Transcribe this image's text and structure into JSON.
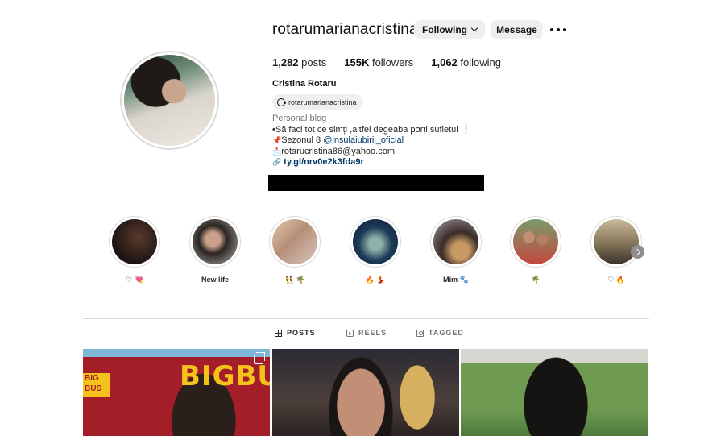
{
  "profile": {
    "username": "rotarumarianacristina",
    "verified": true,
    "following_label": "Following",
    "message_label": "Message",
    "posts_count": "1,282",
    "posts_label": "posts",
    "followers_count": "155K",
    "followers_label": "followers",
    "following_count": "1,062",
    "following_text": "following",
    "full_name": "Cristina Rotaru",
    "threads_handle": "rotarumarianacristina",
    "category": "Personal blog",
    "bio_line1": "•Să faci tot ce simți ,altfel degeaba porți sufletul ❕",
    "bio_line2_prefix": "Sezonul 8 ",
    "bio_line2_mention": "@insulaiubirii_oficial",
    "bio_line3": "rotarucristina86@yahoo.com",
    "bio_link": "ty.gl/nrv0e2k3fda9r"
  },
  "highlights": [
    {
      "label": "♡ 💘"
    },
    {
      "label": "New life"
    },
    {
      "label": "👯 🌴"
    },
    {
      "label": "🔥 💃"
    },
    {
      "label": "Mim 🐾"
    },
    {
      "label": "🌴"
    },
    {
      "label": "♡ 🔥"
    }
  ],
  "tabs": {
    "posts": "POSTS",
    "reels": "REELS",
    "tagged": "TAGGED"
  },
  "posts": [
    {
      "overlay_text": "BIGBU",
      "logo_text": "BIG BUS"
    },
    {},
    {}
  ],
  "colors": {
    "verified_blue": "#0095f6",
    "link_blue": "#00376b",
    "button_grey": "#efefef",
    "divider": "#dbdbdb"
  }
}
